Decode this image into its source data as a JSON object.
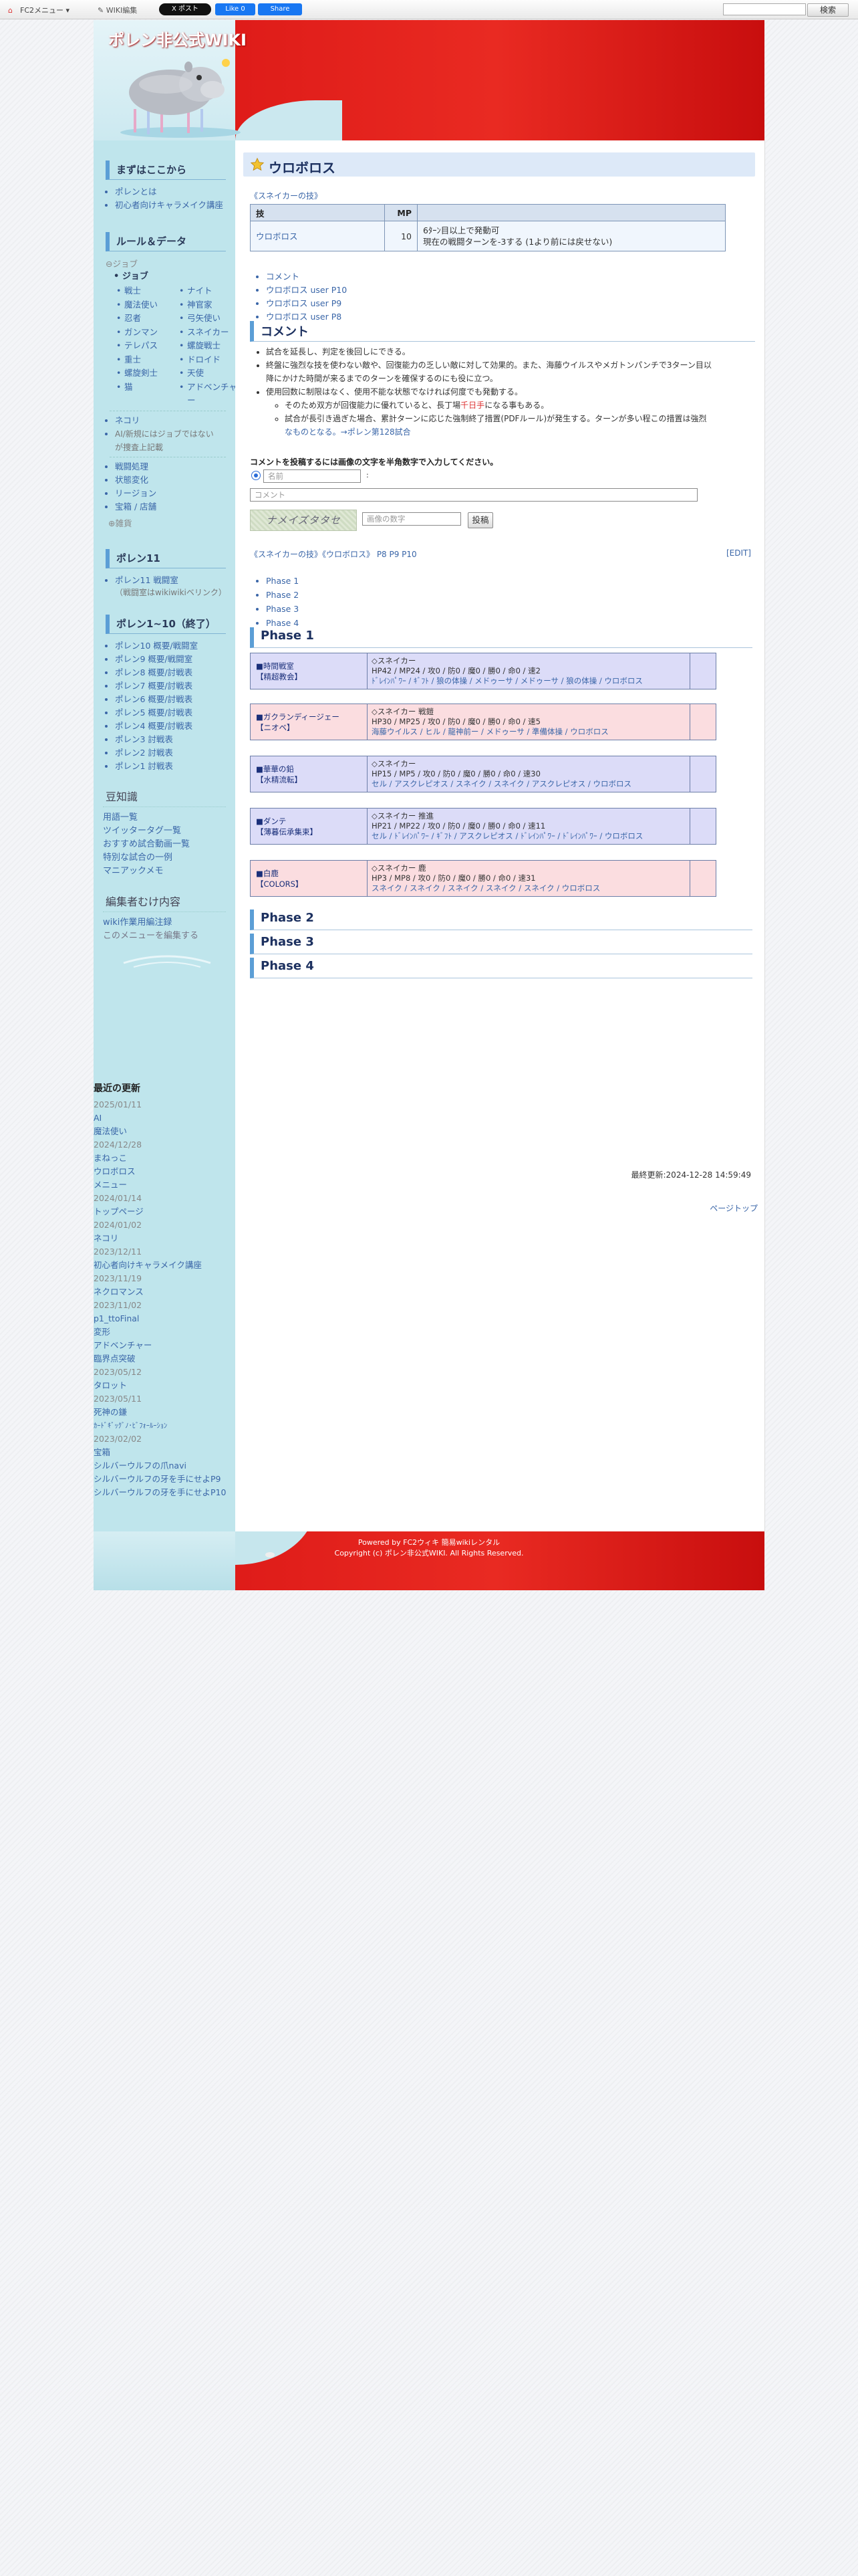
{
  "topbar": {
    "fc2_menu": "FC2メニュー",
    "wiki_edit": "WIKI編集",
    "post": "X ポスト",
    "like": "Like 0",
    "share": "Share",
    "search_button": "検索"
  },
  "site": {
    "title": "ポレン非公式WIKI"
  },
  "sidebar": {
    "start_heading": "まずはここから",
    "start_items": [
      "ポレンとは",
      "初心者向けキャラメイク講座"
    ],
    "rules_heading": "ルール＆データ",
    "job_head": "⊖ジョブ",
    "job_sub": "ジョブ",
    "jobs": [
      "戦士",
      "ナイト",
      "魔法使い",
      "神官家",
      "忍者",
      "弓矢使い",
      "ガンマン",
      "スネイカー",
      "テレパス",
      "螺旋戦士",
      "重士",
      "ドロイド",
      "螺旋剣士",
      "天使",
      "猫",
      "アドベンチャー"
    ],
    "extra_items": [
      {
        "label": "ネコリ"
      },
      {
        "label": "AI/新規にはジョブではない"
      },
      {
        "label": "が捜査上記載"
      }
    ],
    "note": "AI新規にはジョブではない\nが捜査上記載",
    "rules_items": [
      "戦闘処理",
      "状態変化",
      "リージョン",
      "宝箱 / 店舗"
    ],
    "collapsed": "⊕雑貨",
    "p11_heading": "ポレン11",
    "p11_items": [
      "ポレン11 戦闘室"
    ],
    "p11_note": "（戦闘室はwikiwikiベリンク）",
    "p110_heading": "ポレン1~10（終了）",
    "p110_items": [
      "ポレン10 概要/戦闘室",
      "ポレン9 概要/戦闘室",
      "ポレン8 概要/討戦表",
      "ポレン7 概要/討戦表",
      "ポレン6 概要/討戦表",
      "ポレン5 概要/討戦表",
      "ポレン4 概要/討戦表",
      "ポレン3 討戦表",
      "ポレン2 討戦表",
      "ポレン1 討戦表"
    ],
    "trivia_heading": "豆知識",
    "trivia_items": [
      "用語一覧",
      "ツイッタータグ一覧",
      "おすすめ試合動画一覧",
      "特別な試合の一例",
      "マニアックメモ"
    ],
    "edit_heading": "編集者むけ内容",
    "edit_items": [
      "wiki作業用編注録",
      "このメニューを編集する"
    ]
  },
  "recent": {
    "heading": "最近の更新",
    "entries": [
      {
        "date": "2025/01/11",
        "pages": [
          "AI",
          "魔法使い"
        ]
      },
      {
        "date": "2024/12/28",
        "pages": [
          "まねっこ",
          "ウロボロス",
          "メニュー"
        ]
      },
      {
        "date": "2024/01/14",
        "pages": [
          "トップページ"
        ]
      },
      {
        "date": "2024/01/02",
        "pages": [
          "ネコリ"
        ]
      },
      {
        "date": "2023/12/11",
        "pages": [
          "初心者向けキャラメイク講座"
        ]
      },
      {
        "date": "2023/11/19",
        "pages": [
          "ネクロマンス"
        ]
      },
      {
        "date": "2023/11/02",
        "pages": [
          "p1_ttoFinal",
          "変形",
          "アドベンチャー",
          "臨界点突破"
        ]
      },
      {
        "date": "2023/05/12",
        "pages": [
          "タロット"
        ]
      },
      {
        "date": "2023/05/11",
        "pages": [
          "死神の鎌",
          "ｶｰﾄﾞｷﾞｯｸﾞﾉ･ﾋﾞﾌｫｰﾙｰｼｮﾝ"
        ]
      },
      {
        "date": "2023/02/02",
        "pages": [
          "宝箱",
          "シルバーウルフの爪navi",
          "シルバーウルフの牙を手にせよP9",
          "シルバーウルフの牙を手にせよP10"
        ]
      }
    ]
  },
  "main": {
    "page_title": "ウロボロス",
    "crumb": "《スネイカーの技》",
    "skill_table": {
      "headers": [
        "技",
        "MP",
        ""
      ],
      "row": {
        "name": "ウロボロス",
        "mp": "10",
        "desc_lines": [
          "6ﾀｰﾝ目以上で発動可",
          "現在の戦闘ターンを-3する (1より前には戻せない)"
        ]
      }
    },
    "toc1": [
      "コメント",
      "ウロボロス user P10",
      "ウロボロス user P9",
      "ウロボロス user P8"
    ],
    "comment_heading": "コメント",
    "comments": [
      "試合を延長し、判定を後回しにできる。",
      "終盤に強烈な技を使わない敵や、回復能力の乏しい敵に対して効果的。また、海藤ウイルスやメガトンパンチで3ターン目以",
      "降にかけた時間が来るまでのターンを確保するのにも役に立つ。",
      "使用回数に制限はなく、使用不能な状態でなければ何度でも発動する。"
    ],
    "sub_comments": [
      {
        "pre": "そのため双方が回復能力に優れていると、長丁場",
        "red": "千日手",
        "post": "になる事もある。"
      },
      {
        "pre": "試合が長引き過ぎた場合、累計ターンに応じた強制終了措置(PDFルール)が発生する。ターンが多い程この措置は強烈",
        "red": "",
        "post": ""
      },
      {
        "pre": "なものとなる。→ポレン第128試合",
        "red": "",
        "post": ""
      }
    ],
    "form": {
      "instruction": "コメントを投稿するには画像の文字を半角数字で入力してください。",
      "name_placeholder": "名前",
      "comment_placeholder": "コメント",
      "captcha_text": "ナメイズタタセ",
      "captcha_placeholder": "画像の数字",
      "post_label": "投稿"
    },
    "nav_crumb": "《スネイカーの技》《ウロボロス》 P8 P9 P10",
    "edit_label": "[EDIT]",
    "toc2": [
      "Phase 1",
      "Phase 2",
      "Phase 3",
      "Phase 4"
    ],
    "phase_headings": [
      "Phase 1",
      "Phase 2",
      "Phase 3",
      "Phase 4"
    ],
    "encounters": [
      {
        "color": "blue",
        "c1a": "■時間戦室",
        "c1b": "【精超教会】",
        "c2a": "◇スネイカー",
        "c2b": "HP42 / MP24 / 攻0 / 防0 / 魔0 / 勝0 / 命0 / 速2",
        "c2c": "ﾄﾞﾚｲﾝﾊﾟﾜｰ / ｷﾞﾌﾄ / 狼の体操 / メドゥーサ / メドゥーサ / 狼の体操 / ウロボロス"
      },
      {
        "color": "pink",
        "c1a": "■ガクランディージェー",
        "c1b": "【ニオベ】",
        "c2a": "◇スネイカー 戦鎧",
        "c2b": "HP30 / MP25 / 攻0 / 防0 / 魔0 / 勝0 / 命0 / 速5",
        "c2c": "海藤ウイルス / ヒル / 龍神前ー / メドゥーサ / 準備体操 / ウロボロス"
      },
      {
        "color": "blue",
        "c1a": "■華華の鉛",
        "c1b": "【水精流転】",
        "c2a": "◇スネイカー",
        "c2b": "HP15 / MP5 / 攻0 / 防0 / 魔0 / 勝0 / 命0 / 速30",
        "c2c": "セル / アスクレピオス / スネイク / スネイク / アスクレピオス / ウロボロス"
      },
      {
        "color": "blue",
        "c1a": "■ダンテ",
        "c1b": "【薄暮伝承集束】",
        "c2a": "◇スネイカー 推進",
        "c2b": "HP21 / MP22 / 攻0 / 防0 / 魔0 / 勝0 / 命0 / 速11",
        "c2c": "セル / ﾄﾞﾚｲﾝﾊﾟﾜｰ / ｷﾞﾌﾄ / アスクレピオス / ﾄﾞﾚｲﾝﾊﾟﾜｰ / ﾄﾞﾚｲﾝﾊﾟﾜｰ / ウロボロス"
      },
      {
        "color": "pink",
        "c1a": "■白鹿",
        "c1b": "【COLORS】",
        "c2a": "◇スネイカー 鹿",
        "c2b": "HP3 / MP8 / 攻0 / 防0 / 魔0 / 勝0 / 命0 / 速31",
        "c2c": "スネイク / スネイク / スネイク / スネイク / スネイク / ウロボロス"
      }
    ],
    "last_updated": "最終更新:2024-12-28 14:59:49",
    "page_top": "ページトップ"
  },
  "footer": {
    "powered": "Powered by FC2ウィキ 簡易wikiレンタル",
    "copyright": "Copyright (c) ポレン非公式WIKI. All Rights Reserved."
  },
  "colors": {
    "header_red": "#e01e1a",
    "sidebar_blue": "#bfe5ec",
    "link": "#3a66a8",
    "heading_bar": "#5b9ed6"
  }
}
